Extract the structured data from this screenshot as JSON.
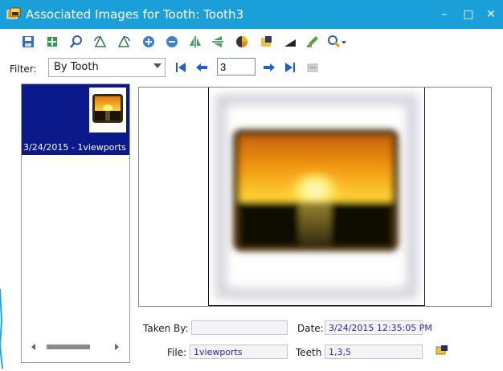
{
  "window": {
    "title": "Associated Images for Tooth: Tooth3",
    "controls": {
      "minimize": "–",
      "maximize": "□",
      "close": "✕"
    }
  },
  "toolbar": {
    "icons": [
      "save-icon",
      "move-icon",
      "zoom-icon",
      "rotate-left-icon",
      "rotate-right-icon",
      "zoom-in-icon",
      "zoom-out-icon",
      "flip-vertical-icon",
      "flip-horizontal-icon",
      "color-icon",
      "scan-icon",
      "brightness-icon",
      "edit-icon",
      "search-dropdown-icon"
    ]
  },
  "filter": {
    "label": "Filter:",
    "selected": "By Tooth",
    "page": "3"
  },
  "thumbnails": [
    {
      "caption": "3/24/2015 - 1viewports",
      "selected": true
    }
  ],
  "details": {
    "taken_by_label": "Taken By:",
    "taken_by_value": "",
    "date_label": "Date:",
    "date_value": "3/24/2015 12:35:05 PM",
    "file_label": "File:",
    "file_value": "1viewports",
    "teeth_label": "Teeth",
    "teeth_value": "1,3,5"
  },
  "colors": {
    "titlebar": "#1a9fd8",
    "selection": "#0a1a8a",
    "field_text": "#2a2aa8"
  }
}
